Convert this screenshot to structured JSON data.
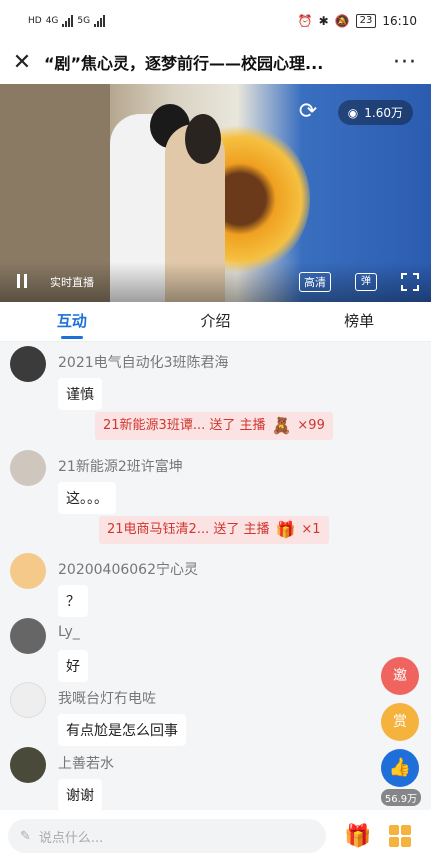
{
  "status_bar": {
    "network_left": "HD",
    "network_4g": "4G",
    "network_5g": "5G",
    "battery": "23",
    "time": "16:10"
  },
  "header": {
    "title": "“剧”焦心灵，逐梦前行——校园心理..."
  },
  "video": {
    "views": "1.60万",
    "live_label": "实时直播",
    "quality_label": "高清",
    "danmu_label": "弹"
  },
  "tabs": [
    "互动",
    "介绍",
    "榜单"
  ],
  "feed": {
    "messages": [
      {
        "user": "2021电气自动化3班陈君海",
        "text": "谨慎",
        "avatar_color": "#3b3b3b"
      },
      {
        "user": "21新能源2班许富坤",
        "text": "这。。。",
        "avatar_color": "#cfc6bd"
      },
      {
        "user": "20200406062宁心灵",
        "text": "？",
        "avatar_color": "#f5c98a"
      },
      {
        "user": "Ly_",
        "text": "好",
        "avatar_color": "#666666"
      },
      {
        "user": "我嘅台灯冇电咗",
        "text": "有点尬是怎么回事",
        "avatar_color": "#eeeeee"
      },
      {
        "user": "上善若水",
        "text": "谢谢",
        "avatar_color": "#4a4a3a"
      }
    ],
    "gifts": [
      {
        "text": "21新能源3班谭... 送了 主播",
        "icon": "🧸",
        "count": "×99"
      },
      {
        "text": "21电商马钰清2... 送了 主播",
        "icon": "🎁",
        "count": "×1"
      }
    ]
  },
  "float": {
    "invite": "邀",
    "reward": "赏",
    "likes": "56.9万"
  },
  "input": {
    "placeholder": "说点什么..."
  },
  "colors": {
    "accent": "#1e6fd9",
    "gift_bg": "#fbe3e3",
    "gift_text": "#d0362e"
  }
}
